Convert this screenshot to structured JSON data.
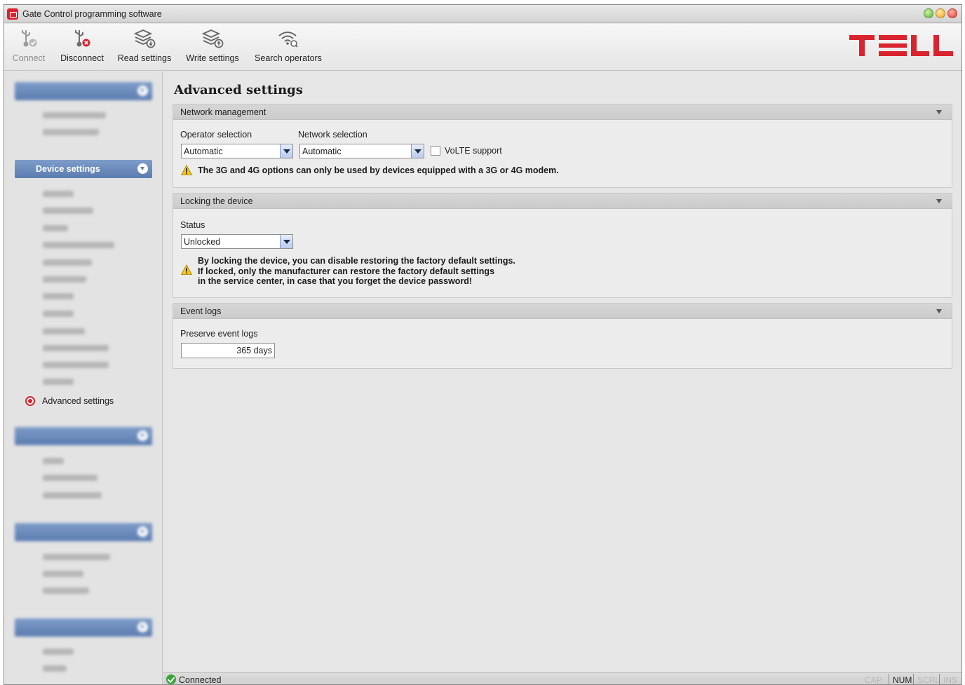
{
  "window": {
    "title": "Gate Control programming software"
  },
  "toolbar": {
    "connect": "Connect",
    "disconnect": "Disconnect",
    "read_settings": "Read settings",
    "write_settings": "Write settings",
    "search_operators": "Search operators"
  },
  "logo": {
    "text": "TELL",
    "color": "#d9232f"
  },
  "sidebar": {
    "device_settings": "Device settings",
    "active_item": "Advanced settings"
  },
  "page": {
    "title": "Advanced settings"
  },
  "network": {
    "header": "Network management",
    "operator_label": "Operator selection",
    "operator_value": "Automatic",
    "network_label": "Network selection",
    "network_value": "Automatic",
    "volte_label": "VoLTE support",
    "volte_checked": false,
    "warning": "The 3G and 4G options can only be used by devices equipped with a 3G or 4G modem."
  },
  "locking": {
    "header": "Locking the device",
    "status_label": "Status",
    "status_value": "Unlocked",
    "warning_line1": "By locking the device, you can disable restoring the factory default settings.",
    "warning_line2": "If locked, only the manufacturer can restore the factory default settings",
    "warning_line3": "in the service center, in case that you forget the device password!"
  },
  "event_logs": {
    "header": "Event logs",
    "preserve_label": "Preserve event logs",
    "preserve_value": "365 days"
  },
  "statusbar": {
    "status": "Connected",
    "num": "NUM"
  },
  "colors": {
    "accent_red": "#d9232f",
    "sidebar_group": "#5b7cb0",
    "status_ok": "#3aa43a"
  }
}
